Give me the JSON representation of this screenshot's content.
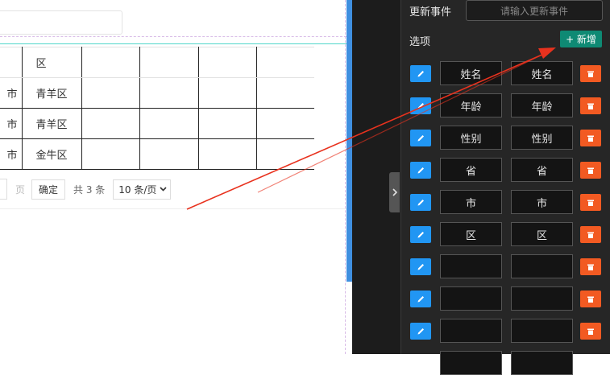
{
  "table": {
    "header": [
      "",
      "区",
      "",
      "",
      "",
      ""
    ],
    "rows": [
      [
        "市",
        "青羊区",
        "",
        "",
        "",
        ""
      ],
      [
        "市",
        "青羊区",
        "",
        "",
        "",
        ""
      ],
      [
        "市",
        "金牛区",
        "",
        "",
        "",
        ""
      ]
    ]
  },
  "pager": {
    "page_unit": "页",
    "confirm": "确定",
    "total": "共 3 条",
    "page_size": "10 条/页"
  },
  "panel": {
    "event_label": "更新事件",
    "event_placeholder": "请输入更新事件",
    "options_label": "选项",
    "add_button": "+ 新增",
    "options": [
      {
        "label": "姓名",
        "value": "姓名"
      },
      {
        "label": "年龄",
        "value": "年龄"
      },
      {
        "label": "性别",
        "value": "性别"
      },
      {
        "label": "省",
        "value": "省"
      },
      {
        "label": "市",
        "value": "市"
      },
      {
        "label": "区",
        "value": "区"
      },
      {
        "label": "",
        "value": ""
      },
      {
        "label": "",
        "value": ""
      },
      {
        "label": "",
        "value": ""
      }
    ]
  },
  "colors": {
    "accent_teal": "#0f8a74",
    "edit_blue": "#2196f3",
    "delete_orange": "#f25a22",
    "arrow_red": "#e8321e"
  },
  "icons": {
    "edit": "pencil-icon",
    "delete": "trash-icon",
    "collapse": "chevron-right-icon",
    "select": "chevron-down-icon"
  }
}
